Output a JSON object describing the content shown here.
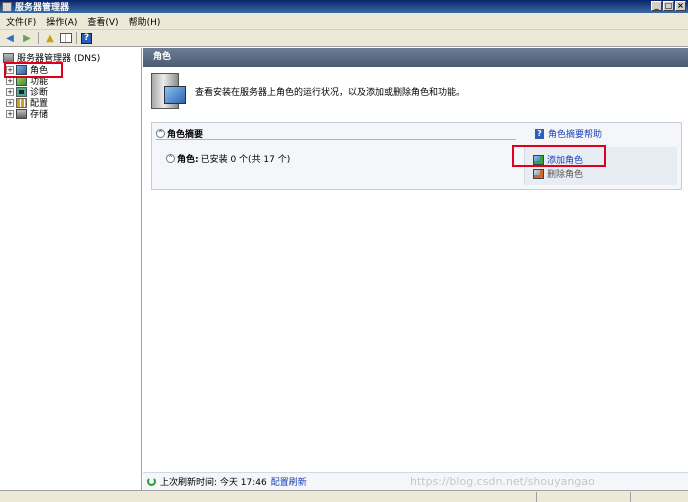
{
  "window": {
    "title": "服务器管理器",
    "buttons": [
      "_",
      "□",
      "×"
    ]
  },
  "menu": {
    "items": [
      "文件(F)",
      "操作(A)",
      "查看(V)",
      "帮助(H)"
    ]
  },
  "toolbar": {
    "help_label": "?"
  },
  "tree": {
    "root": "服务器管理器 (DNS)",
    "items": [
      "角色",
      "功能",
      "诊断",
      "配置",
      "存储"
    ],
    "expander": "+"
  },
  "content": {
    "header": "角色",
    "description": "查看安装在服务器上角色的运行状况，以及添加或删除角色和功能。",
    "summary": {
      "title": "角色摘要",
      "help_link": "角色摘要帮助",
      "roles_label": "角色:",
      "roles_value": "已安装 0 个(共 17 个)",
      "add_roles": "添加角色",
      "remove_roles": "删除角色",
      "collapse_glyph": "^"
    },
    "status": {
      "last_refresh_label": "上次刷新时间: 今天 17:46",
      "configure_refresh": "配置刷新"
    }
  },
  "watermark": "https://blog.csdn.net/shouyangao",
  "colors": {
    "highlight": "#e0001a",
    "link": "#1a3fb8",
    "header_bg": "#5a6a82"
  }
}
